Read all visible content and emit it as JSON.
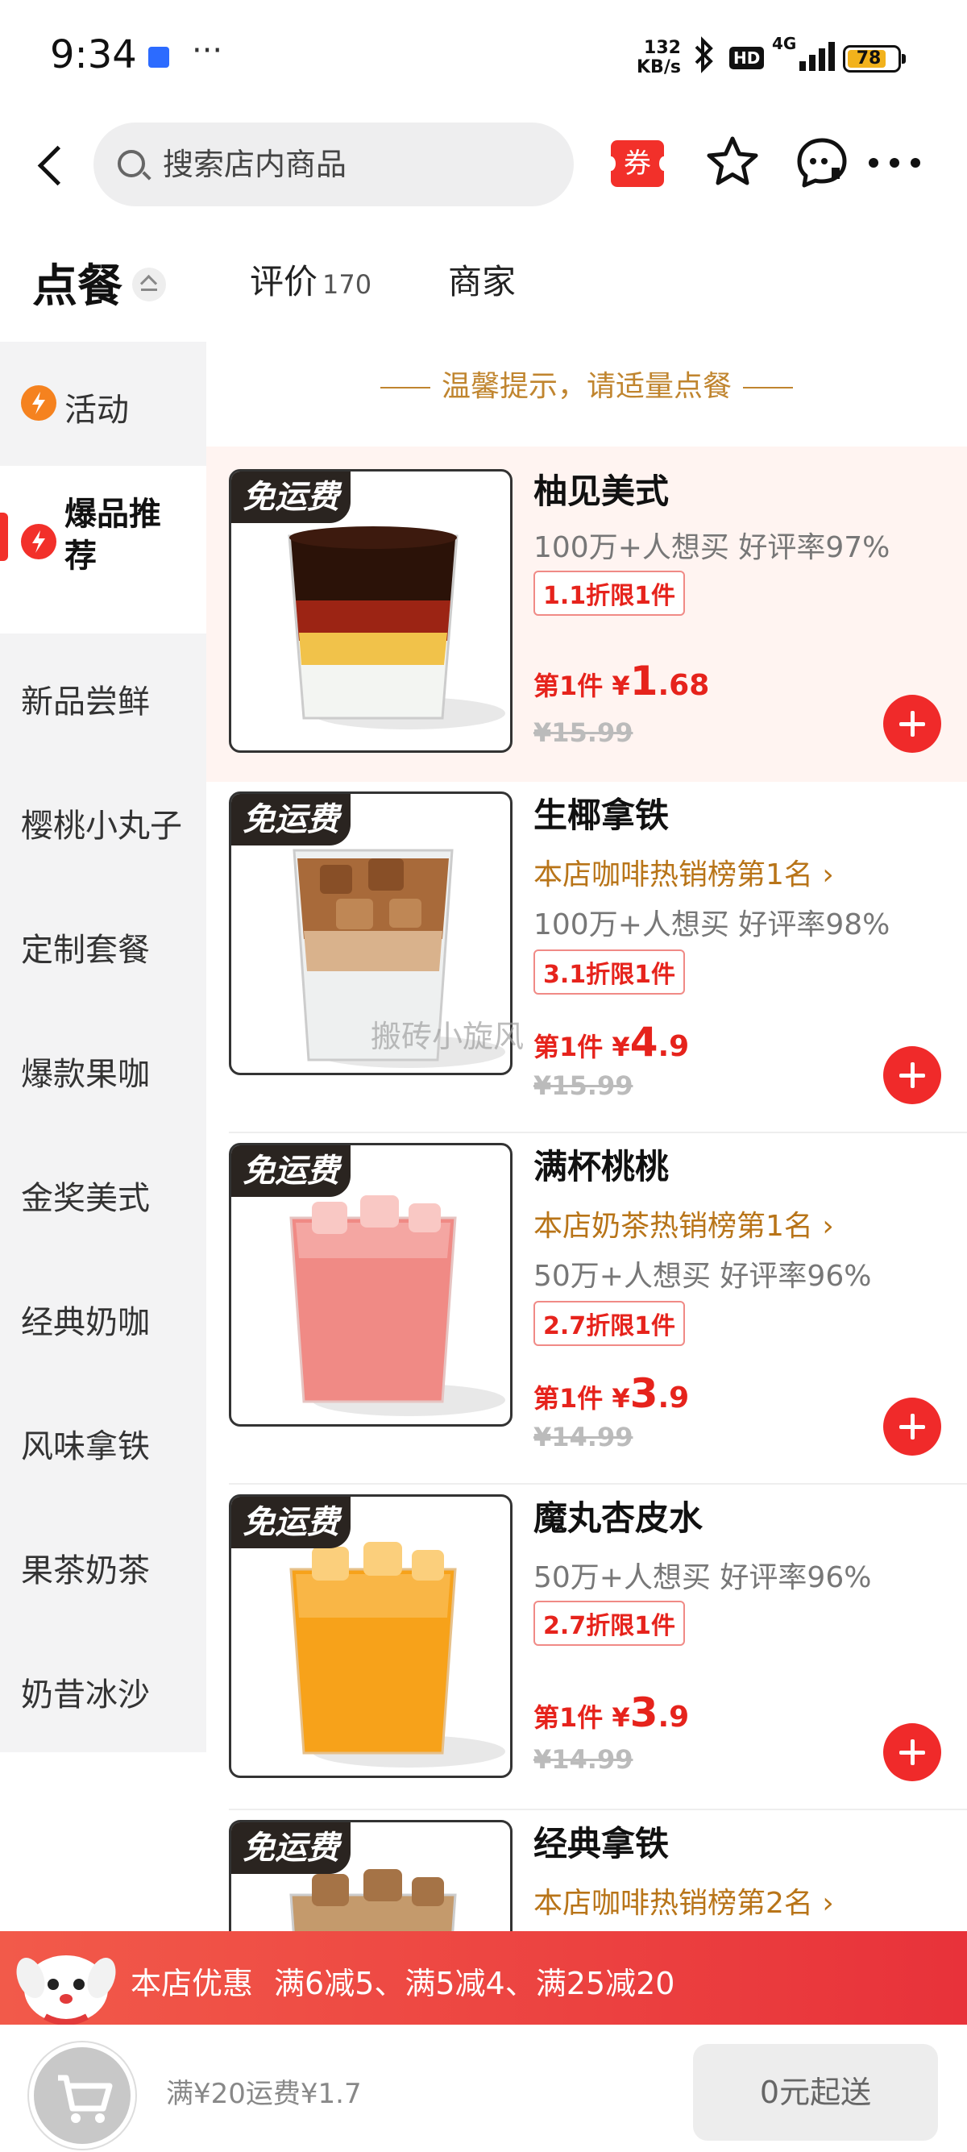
{
  "status_bar": {
    "time": "9:34",
    "more": "···",
    "net_speed_value": "132",
    "net_speed_unit": "KB/s",
    "hd": "HD",
    "network": "4G",
    "battery": "78",
    "battery_level": 0.78
  },
  "nav": {
    "search_placeholder": "搜索店内商品",
    "coupon_label": "券"
  },
  "tabs": [
    {
      "label": "点餐"
    },
    {
      "label": "评价",
      "count": "170"
    },
    {
      "label": "商家"
    }
  ],
  "sidebar": {
    "items": [
      {
        "label": "活动"
      },
      {
        "label": "爆品推荐"
      },
      {
        "label": "新品尝鲜"
      },
      {
        "label": "樱桃小丸子"
      },
      {
        "label": "定制套餐"
      },
      {
        "label": "爆款果咖"
      },
      {
        "label": "金奖美式"
      },
      {
        "label": "经典奶咖"
      },
      {
        "label": "风味拿铁"
      },
      {
        "label": "果茶奶茶"
      },
      {
        "label": "奶昔冰沙"
      }
    ]
  },
  "notice": "温馨提示，请适量点餐",
  "products": [
    {
      "badge": "免运费",
      "name": "柚见美式",
      "rank": "",
      "stats": "100万+人想买  好评率97%",
      "discount": "1.1折限1件",
      "price_prefix": "第1件 ¥",
      "price_int": "1",
      "price_dec": ".68",
      "original": "¥15.99"
    },
    {
      "badge": "免运费",
      "name": "生椰拿铁",
      "rank": "本店咖啡热销榜第1名 ›",
      "stats": "100万+人想买  好评率98%",
      "discount": "3.1折限1件",
      "price_prefix": "第1件 ¥",
      "price_int": "4",
      "price_dec": ".9",
      "original": "¥15.99"
    },
    {
      "badge": "免运费",
      "name": "满杯桃桃",
      "rank": "本店奶茶热销榜第1名 ›",
      "stats": "50万+人想买  好评率96%",
      "discount": "2.7折限1件",
      "price_prefix": "第1件 ¥",
      "price_int": "3",
      "price_dec": ".9",
      "original": "¥14.99"
    },
    {
      "badge": "免运费",
      "name": "魔丸杏皮水",
      "rank": "",
      "stats": "50万+人想买  好评率96%",
      "discount": "2.7折限1件",
      "price_prefix": "第1件 ¥",
      "price_int": "3",
      "price_dec": ".9",
      "original": "¥14.99"
    },
    {
      "badge": "免运费",
      "name": "经典拿铁",
      "rank": "本店咖啡热销榜第2名 ›"
    }
  ],
  "watermark": "搬砖小旋风",
  "promo": {
    "title": "本店优惠",
    "deals": "满6减5、满5减4、满25减20"
  },
  "bottom": {
    "fee": "满¥20运费¥1.7",
    "min_order": "0元起送"
  },
  "colors": {
    "accent": "#f02a2a",
    "rank_text": "#b87418",
    "highlight_bg": "#fff4f1",
    "promo_bg": "#e8323a"
  }
}
